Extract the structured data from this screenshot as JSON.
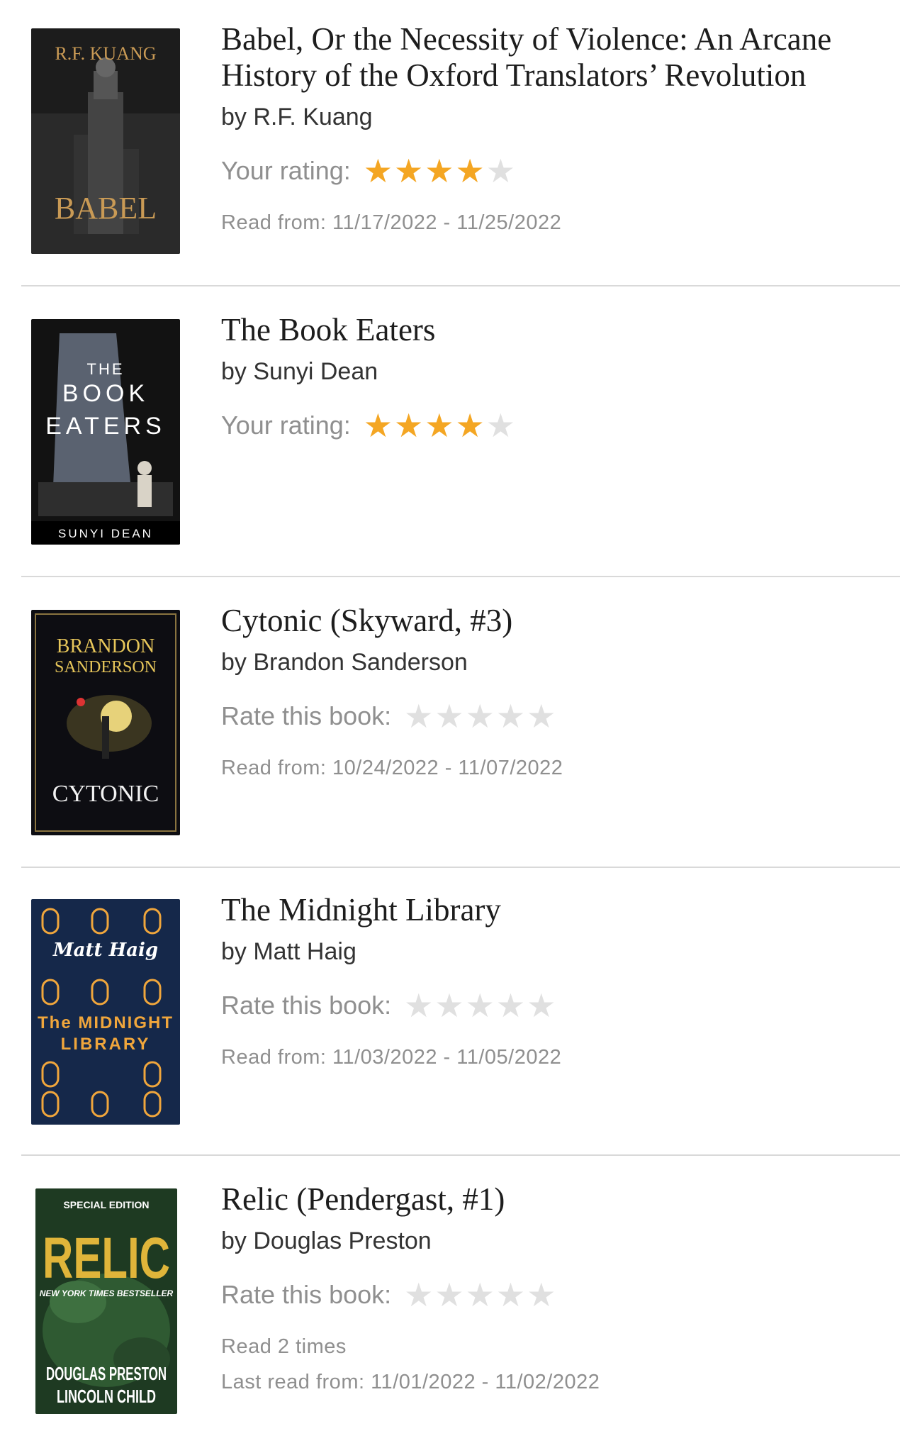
{
  "books": [
    {
      "title": "Babel, Or the Necessity of Violence: An Arcane History of the Oxford Translators’ Revolution",
      "author": "by R.F. Kuang",
      "rating_label": "Your rating:",
      "stars": 4,
      "read_count": "",
      "read_dates": "Read from: 11/17/2022 - 11/25/2022",
      "cover": {
        "name": "babel-cover",
        "top_text": "R.F. KUANG",
        "big_text": "BABEL",
        "bg": "#1c1c1c",
        "accent": "#c99a55"
      }
    },
    {
      "title": "The Book Eaters",
      "author": "by Sunyi Dean",
      "rating_label": "Your rating:",
      "stars": 4,
      "read_count": "",
      "read_dates": "",
      "cover": {
        "name": "book-eaters-cover",
        "line1": "THE",
        "line2": "BOOK",
        "line3": "EATERS",
        "bottom_text": "SUNYI DEAN",
        "bg": "#121212"
      }
    },
    {
      "title": "Cytonic (Skyward, #3)",
      "author": "by Brandon Sanderson",
      "rating_label": "Rate this book:",
      "stars": 0,
      "read_count": "",
      "read_dates": "Read from: 10/24/2022 - 11/07/2022",
      "cover": {
        "name": "cytonic-cover",
        "line1": "BRANDON",
        "line2": "SANDERSON",
        "big_text": "CYTONIC",
        "bg": "#0d0d12",
        "accent": "#e7c65a"
      }
    },
    {
      "title": "The Midnight Library",
      "author": "by Matt Haig",
      "rating_label": "Rate this book:",
      "stars": 0,
      "read_count": "",
      "read_dates": "Read from: 11/03/2022 - 11/05/2022",
      "cover": {
        "name": "midnight-library-cover",
        "line1": "Matt Haig",
        "line2": "The MIDNIGHT",
        "line3": "LIBRARY",
        "bg": "#15284a",
        "accent": "#f0a63c"
      }
    },
    {
      "title": "Relic (Pendergast, #1)",
      "author": "by Douglas Preston",
      "rating_label": "Rate this book:",
      "stars": 0,
      "read_count": "Read 2 times",
      "read_dates": "Last read from: 11/01/2022 - 11/02/2022",
      "cover": {
        "name": "relic-cover",
        "banner": "SPECIAL EDITION",
        "big_text": "RELIC",
        "line1": "NEW YORK TIMES BESTSELLER",
        "line2": "DOUGLAS PRESTON",
        "line3": "LINCOLN CHILD",
        "bg": "#1e3a22",
        "accent": "#e0b53a"
      }
    }
  ]
}
